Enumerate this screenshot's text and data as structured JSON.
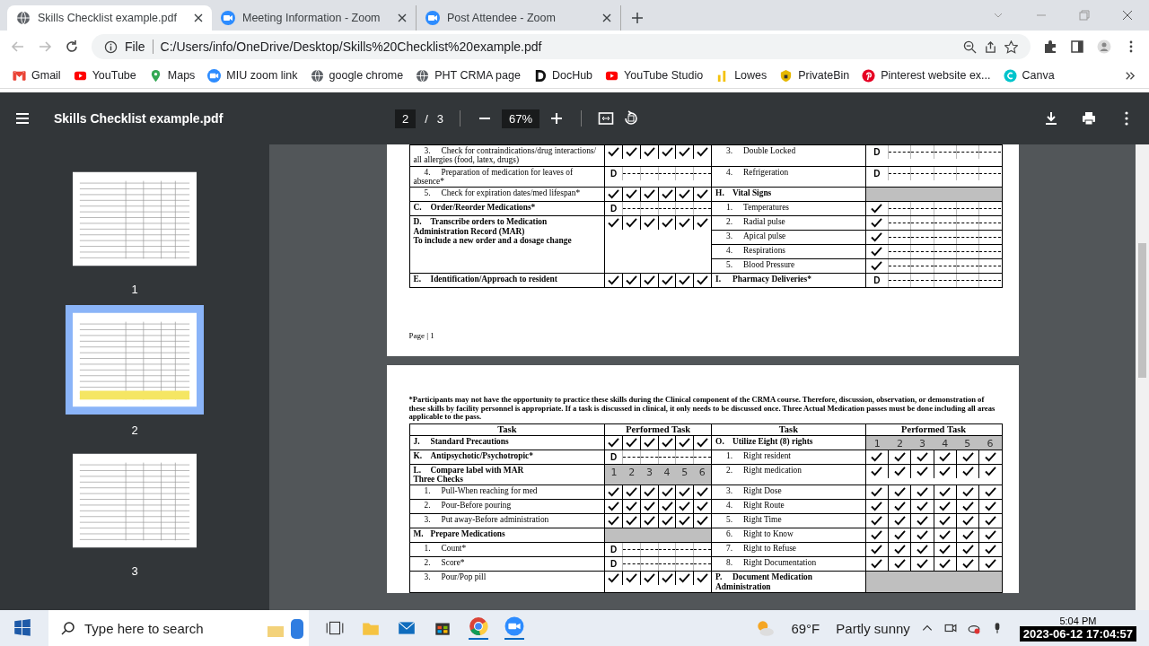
{
  "tabs": [
    {
      "title": "Skills Checklist example.pdf",
      "selected": true
    },
    {
      "title": "Meeting Information - Zoom",
      "selected": false
    },
    {
      "title": "Post Attendee - Zoom",
      "selected": false
    }
  ],
  "address_bar": {
    "scheme": "File",
    "url": "C:/Users/info/OneDrive/Desktop/Skills%20Checklist%20example.pdf"
  },
  "bookmarks": [
    {
      "label": "Gmail"
    },
    {
      "label": "YouTube"
    },
    {
      "label": "Maps"
    },
    {
      "label": "MIU zoom link"
    },
    {
      "label": "google chrome"
    },
    {
      "label": "PHT CRMA page"
    },
    {
      "label": "DocHub"
    },
    {
      "label": "YouTube Studio"
    },
    {
      "label": "Lowes"
    },
    {
      "label": "PrivateBin"
    },
    {
      "label": "Pinterest website ex..."
    },
    {
      "label": "Canva"
    }
  ],
  "pdf_toolbar": {
    "title": "Skills Checklist example.pdf",
    "page": "2",
    "separator": "/",
    "total": "3",
    "zoom": "67%"
  },
  "thumbnails": [
    {
      "label": "1",
      "selected": false
    },
    {
      "label": "2",
      "selected": true
    },
    {
      "label": "3",
      "selected": false
    }
  ],
  "pages": [
    {
      "footer": "Page | 1",
      "rows": [
        {
          "left": {
            "kind": "item",
            "num": "3.",
            "text": "Check for contraindications/drug interactions/ all allergies (food, latex, drugs)",
            "perf": {
              "kind": "checks"
            }
          },
          "right": [
            {
              "kind": "item",
              "num": "3.",
              "text": "Double Locked",
              "perf": {
                "kind": "discuss",
                "text": "D"
              }
            }
          ]
        },
        {
          "left": {
            "kind": "item",
            "num": "4.",
            "text": "Preparation of medication for leaves of absence*",
            "perf": {
              "kind": "discuss",
              "text": "D"
            }
          },
          "right": [
            {
              "kind": "item",
              "num": "4.",
              "text": "Refrigeration",
              "perf": {
                "kind": "discuss",
                "text": "D"
              }
            }
          ]
        },
        {
          "left": {
            "kind": "item",
            "num": "5.",
            "text": "Check for expiration dates/med lifespan*",
            "perf": {
              "kind": "checks"
            }
          },
          "right": [
            {
              "kind": "section",
              "num": "H.",
              "text": "Vital Signs",
              "perf": {
                "kind": "shaded"
              }
            }
          ]
        },
        {
          "left": {
            "kind": "section",
            "num": "C.",
            "text": "Order/Reorder Medications*",
            "perf": {
              "kind": "discuss",
              "text": "D"
            }
          },
          "right": [
            {
              "kind": "item",
              "num": "1.",
              "text": "Temperatures",
              "perf": {
                "kind": "check_dash"
              }
            }
          ]
        },
        {
          "left": {
            "kind": "section",
            "num": "D.",
            "text": "Transcribe orders to Medication Administration Record (MAR)\nTo include a new order and a dosage change",
            "perf": {
              "kind": "checks"
            }
          },
          "right": [
            {
              "kind": "item",
              "num": "2.",
              "text": "Radial pulse",
              "perf": {
                "kind": "check_dash"
              }
            },
            {
              "kind": "item",
              "num": "3.",
              "text": "Apical pulse",
              "perf": {
                "kind": "check_dash"
              }
            },
            {
              "kind": "item",
              "num": "4.",
              "text": "Respirations",
              "perf": {
                "kind": "check_dash"
              }
            },
            {
              "kind": "item",
              "num": "5.",
              "text": "Blood Pressure",
              "perf": {
                "kind": "check_dash"
              }
            }
          ]
        },
        {
          "left": {
            "kind": "section",
            "num": "E.",
            "text": "Identification/Approach to resident",
            "perf": {
              "kind": "checks"
            }
          },
          "right": [
            {
              "kind": "section",
              "num": "I.",
              "text": "Pharmacy Deliveries*",
              "perf": {
                "kind": "discuss",
                "text": "D"
              }
            }
          ]
        }
      ]
    },
    {
      "note": "*Participants may not have the opportunity to practice these skills during the Clinical component of the CRMA course.  Therefore, discussion, observation, or demonstration of these skills by facility personnel is appropriate.  If a task is discussed in clinical, it only needs to be discussed once.  Three Actual Medication passes must be done including all areas applicable to the pass.",
      "headers": [
        "Task",
        "Performed Task",
        "Task",
        "Performed Task"
      ],
      "rows": [
        {
          "left": {
            "kind": "section",
            "num": "J.",
            "text": "Standard Precautions",
            "perf": {
              "kind": "checks"
            }
          },
          "right": [
            {
              "kind": "section",
              "num": "O.",
              "text": "Utilize Eight (8) rights",
              "perf": {
                "kind": "numbers",
                "labels": [
                  "1",
                  "2",
                  "3",
                  "4",
                  "5",
                  "6"
                ]
              }
            }
          ]
        },
        {
          "left": {
            "kind": "section",
            "num": "K.",
            "text": "Antipsychotic/Psychotropic*",
            "perf": {
              "kind": "discuss",
              "text": "D"
            }
          },
          "right": [
            {
              "kind": "item",
              "num": "1.",
              "text": "Right resident",
              "perf": {
                "kind": "checks"
              }
            }
          ]
        },
        {
          "left": {
            "kind": "section",
            "num": "L.",
            "text": "Compare label with MAR\nThree Checks",
            "perf": {
              "kind": "numbers",
              "labels": [
                "1",
                "2",
                "3",
                "4",
                "5",
                "6"
              ]
            }
          },
          "right": [
            {
              "kind": "item",
              "num": "2.",
              "text": "Right medication",
              "perf": {
                "kind": "checks"
              }
            }
          ]
        },
        {
          "left": {
            "kind": "item",
            "num": "1.",
            "text": "Pull-When reaching for med",
            "perf": {
              "kind": "checks"
            }
          },
          "right": [
            {
              "kind": "item",
              "num": "3.",
              "text": "Right Dose",
              "perf": {
                "kind": "checks"
              }
            }
          ]
        },
        {
          "left": {
            "kind": "item",
            "num": "2.",
            "text": "Pour-Before pouring",
            "perf": {
              "kind": "checks"
            }
          },
          "right": [
            {
              "kind": "item",
              "num": "4.",
              "text": "Right Route",
              "perf": {
                "kind": "checks"
              }
            }
          ]
        },
        {
          "left": {
            "kind": "item",
            "num": "3.",
            "text": "Put away-Before administration",
            "perf": {
              "kind": "checks"
            }
          },
          "right": [
            {
              "kind": "item",
              "num": "5.",
              "text": "Right Time",
              "perf": {
                "kind": "checks"
              }
            }
          ]
        },
        {
          "left": {
            "kind": "section",
            "num": "M.",
            "text": "Prepare Medications",
            "perf": {
              "kind": "shaded"
            }
          },
          "right": [
            {
              "kind": "item",
              "num": "6.",
              "text": "Right to Know",
              "perf": {
                "kind": "checks"
              }
            }
          ]
        },
        {
          "left": {
            "kind": "item",
            "num": "1.",
            "text": "Count*",
            "perf": {
              "kind": "discuss",
              "text": "D"
            }
          },
          "right": [
            {
              "kind": "item",
              "num": "7.",
              "text": "Right to Refuse",
              "perf": {
                "kind": "checks"
              }
            }
          ]
        },
        {
          "left": {
            "kind": "item",
            "num": "2.",
            "text": "Score*",
            "perf": {
              "kind": "discuss",
              "text": "D"
            }
          },
          "right": [
            {
              "kind": "item",
              "num": "8.",
              "text": "Right Documentation",
              "perf": {
                "kind": "checks"
              }
            }
          ]
        },
        {
          "left": {
            "kind": "item",
            "num": "3.",
            "text": "Pour/Pop pill",
            "perf": {
              "kind": "checks"
            }
          },
          "right": [
            {
              "kind": "section",
              "num": "P.",
              "text": "Document Medication Administration",
              "perf": {
                "kind": "shaded"
              }
            }
          ]
        }
      ]
    }
  ],
  "taskbar": {
    "search_placeholder": "Type here to search",
    "temperature": "69°F",
    "weather": "Partly sunny",
    "time": "5:04 PM",
    "timestamp_overlay": "2023-06-12 17:04:57"
  }
}
